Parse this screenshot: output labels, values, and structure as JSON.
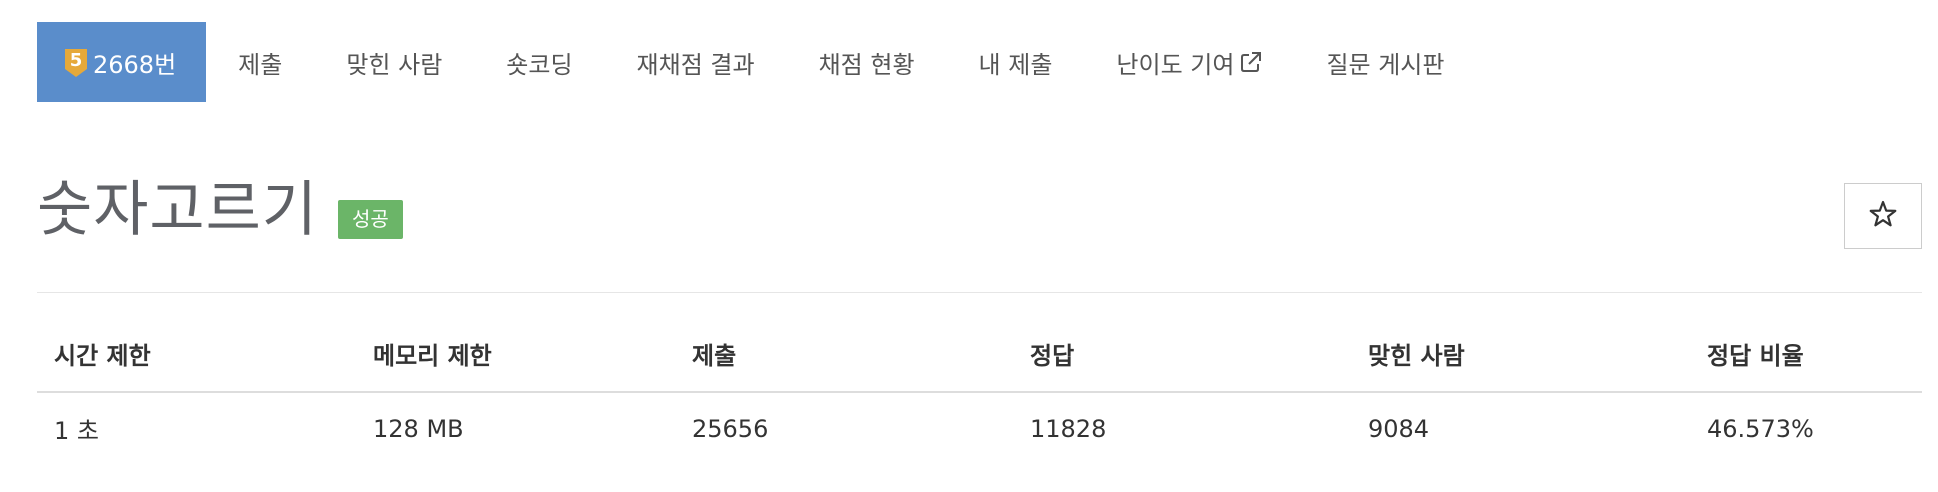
{
  "nav": {
    "problem_tier": "5",
    "problem_number_label": "2668번",
    "items": [
      {
        "label": "제출"
      },
      {
        "label": "맞힌 사람"
      },
      {
        "label": "숏코딩"
      },
      {
        "label": "재채점 결과"
      },
      {
        "label": "채점 현황"
      },
      {
        "label": "내 제출"
      },
      {
        "label": "난이도 기여"
      },
      {
        "label": "질문 게시판"
      }
    ]
  },
  "problem": {
    "title": "숫자고르기",
    "status_label": "성공"
  },
  "info_table": {
    "headers": [
      "시간 제한",
      "메모리 제한",
      "제출",
      "정답",
      "맞힌 사람",
      "정답 비율"
    ],
    "values": [
      "1 초",
      "128 MB",
      "25656",
      "11828",
      "9084",
      "46.573%"
    ]
  },
  "colors": {
    "active_tab_bg": "#5a8dcb",
    "tier_badge": "#e6a93a",
    "status_success": "#6bb568"
  },
  "icons": {
    "tier": "tier-gold-5-icon",
    "external_link": "external-link-icon",
    "favorite": "star-outline-icon"
  }
}
